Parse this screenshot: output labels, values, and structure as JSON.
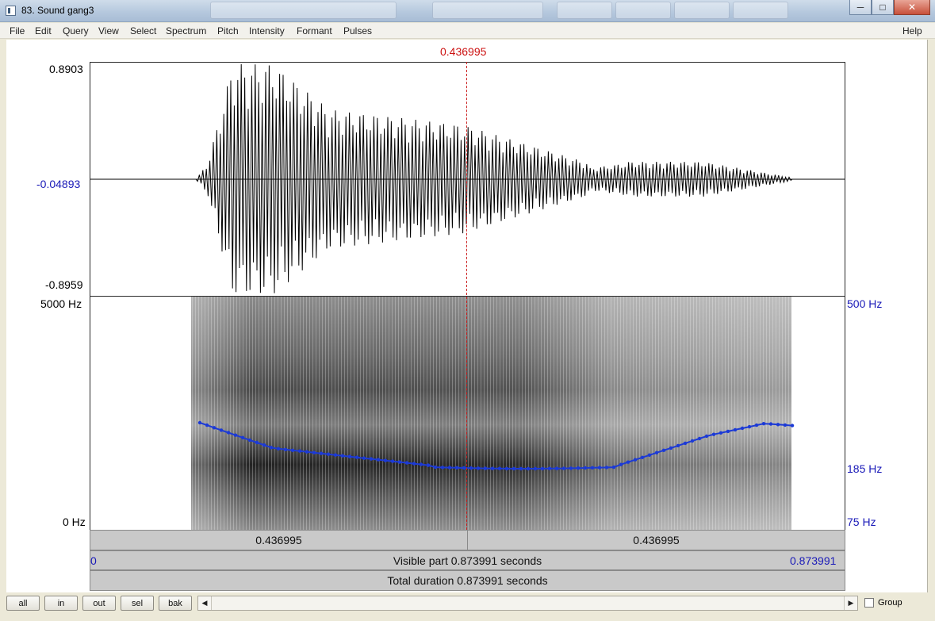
{
  "window": {
    "title": "83. Sound gang3",
    "minimize_label": "─",
    "maximize_label": "□",
    "close_label": "✕"
  },
  "menu": {
    "items": [
      "File",
      "Edit",
      "Query",
      "View",
      "Select",
      "Spectrum",
      "Pitch",
      "Intensity",
      "Formant",
      "Pulses"
    ],
    "help": "Help"
  },
  "cursor": {
    "time_label": "0.436995",
    "fraction": 0.5
  },
  "waveform": {
    "ymax": "0.8903",
    "ymid": "-0.04893",
    "ymin": "-0.8959"
  },
  "spectrogram": {
    "freq_max": "5000 Hz",
    "freq_min": "0 Hz",
    "pitch_max": "500 Hz",
    "pitch_cursor": "185 Hz",
    "pitch_min": "75 Hz"
  },
  "timebar": {
    "left_segment": "0.436995",
    "right_segment": "0.436995"
  },
  "visible": {
    "start": "0",
    "label": "Visible part 0.873991 seconds",
    "end": "0.873991"
  },
  "total": {
    "label": "Total duration 0.873991 seconds"
  },
  "bottom": {
    "buttons": [
      "all",
      "in",
      "out",
      "sel",
      "bak"
    ],
    "left_arrow": "◀",
    "right_arrow": "▶",
    "group_label": "Group"
  }
}
